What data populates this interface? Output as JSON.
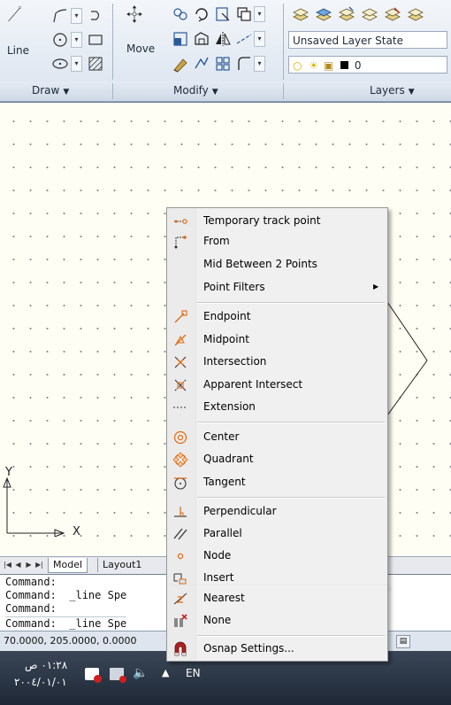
{
  "ribbon": {
    "panels": [
      {
        "label": "Draw"
      },
      {
        "label": "Modify"
      },
      {
        "label": "Layers"
      }
    ],
    "line_label": "Line",
    "move_label": "Move",
    "layer_state": "Unsaved Layer State",
    "current_layer": "0"
  },
  "tabs": {
    "model": "Model",
    "layout1": "Layout1"
  },
  "axis": {
    "x_label": "X",
    "y_label": "Y"
  },
  "command_line": {
    "lines": [
      "Command:",
      "Command:  _line Spe",
      "Command:",
      "Command:  _line Spe"
    ]
  },
  "status": {
    "coordinates": "70.0000, 205.0000, 0.0000"
  },
  "taskbar": {
    "time": "٠١:٢٨ ص",
    "date": "٢٠٠٤/٠١/٠١",
    "language": "EN"
  },
  "context_menu": {
    "groups": [
      [
        {
          "label": "Temporary track point",
          "icon": "temporary-track-point-icon"
        },
        {
          "label": "From",
          "icon": "from-icon"
        },
        {
          "label": "Mid Between 2 Points",
          "icon": ""
        },
        {
          "label": "Point Filters",
          "icon": "",
          "submenu": true
        }
      ],
      [
        {
          "label": "Endpoint",
          "icon": "endpoint-icon"
        },
        {
          "label": "Midpoint",
          "icon": "midpoint-icon"
        },
        {
          "label": "Intersection",
          "icon": "intersection-icon"
        },
        {
          "label": "Apparent Intersect",
          "icon": "apparent-intersect-icon"
        },
        {
          "label": "Extension",
          "icon": "extension-icon"
        }
      ],
      [
        {
          "label": "Center",
          "icon": "center-icon"
        },
        {
          "label": "Quadrant",
          "icon": "quadrant-icon"
        },
        {
          "label": "Tangent",
          "icon": "tangent-icon"
        }
      ],
      [
        {
          "label": "Perpendicular",
          "icon": "perpendicular-icon"
        },
        {
          "label": "Parallel",
          "icon": "parallel-icon"
        },
        {
          "label": "Node",
          "icon": "node-icon"
        },
        {
          "label": "Insert",
          "icon": "insert-icon"
        },
        {
          "label": "Nearest",
          "icon": "nearest-icon"
        },
        {
          "label": "None",
          "icon": "none-icon"
        }
      ],
      [
        {
          "label": "Osnap Settings...",
          "icon": "osnap-settings-icon"
        }
      ]
    ]
  },
  "colors": {
    "canvas_bg": "#fffef4",
    "osnap_orange": "#e06a10",
    "menu_bg": "#f0f0f0"
  }
}
